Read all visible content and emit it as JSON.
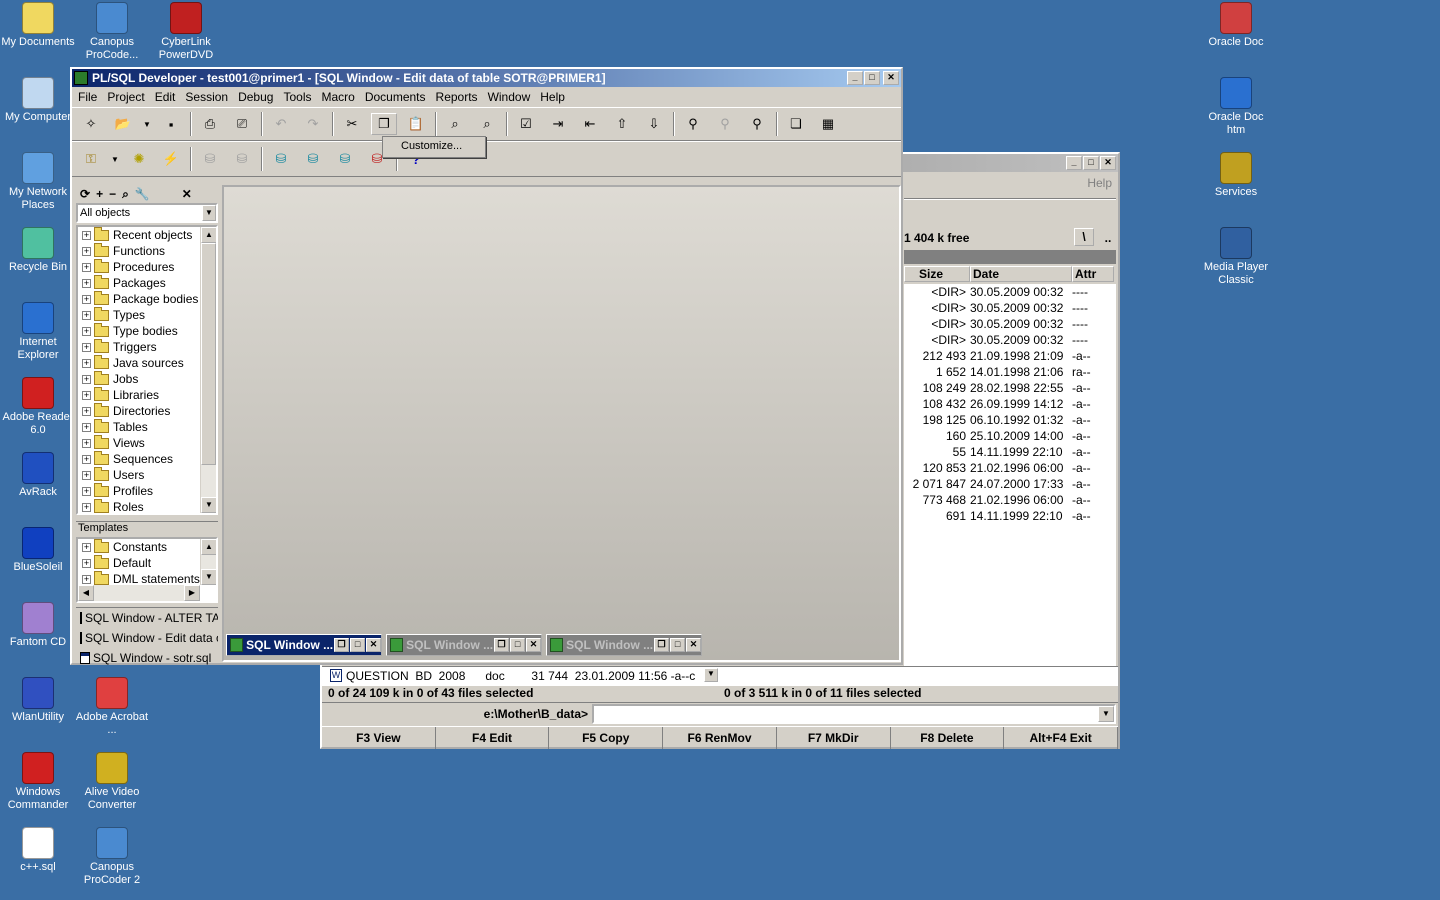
{
  "desktop": {
    "icons_left": [
      {
        "label": "My Documents",
        "icon": "folder-documents-icon"
      },
      {
        "label": "Canopus ProCode...",
        "icon": "canopus-icon"
      },
      {
        "label": "CyberLink PowerDVD",
        "icon": "dvd-icon"
      },
      {
        "label": "My Computer",
        "icon": "computer-icon"
      },
      {
        "label": "My Network Places",
        "icon": "network-icon"
      },
      {
        "label": "Recycle Bin",
        "icon": "recycle-bin-icon"
      },
      {
        "label": "Internet Explorer",
        "icon": "ie-icon"
      },
      {
        "label": "Adobe Reader 6.0",
        "icon": "adobe-reader-icon"
      },
      {
        "label": "AvRack",
        "icon": "avrack-icon"
      },
      {
        "label": "BlueSoleil",
        "icon": "bluetooth-icon"
      },
      {
        "label": "Fantom CD",
        "icon": "fantom-cd-icon"
      },
      {
        "label": "WlanUtility",
        "icon": "wlan-icon"
      },
      {
        "label": "Adobe Acrobat ...",
        "icon": "acrobat-icon"
      },
      {
        "label": "Windows Commander",
        "icon": "floppy-icon"
      },
      {
        "label": "Alive Video Converter",
        "icon": "video-converter-icon"
      },
      {
        "label": "c++.sql",
        "icon": "sql-file-icon"
      },
      {
        "label": "Canopus ProCoder 2",
        "icon": "canopus-icon"
      }
    ],
    "icons_right": [
      {
        "label": "Oracle Doc",
        "icon": "oracle-doc-icon"
      },
      {
        "label": "Oracle Doc htm",
        "icon": "ie-icon"
      },
      {
        "label": "Services",
        "icon": "gears-icon"
      },
      {
        "label": "Media Player Classic",
        "icon": "media-player-icon"
      }
    ]
  },
  "commander": {
    "help": "Help",
    "free": "1 404 k free",
    "root_btn": "\\",
    "up_btn": "..",
    "columns": [
      "Size",
      "Date",
      "Attr"
    ],
    "rows": [
      {
        "size": "<DIR>",
        "date": "30.05.2009 00:32",
        "attr": "----"
      },
      {
        "size": "<DIR>",
        "date": "30.05.2009 00:32",
        "attr": "----"
      },
      {
        "size": "<DIR>",
        "date": "30.05.2009 00:32",
        "attr": "----"
      },
      {
        "size": "<DIR>",
        "date": "30.05.2009 00:32",
        "attr": "----"
      },
      {
        "size": "212 493",
        "date": "21.09.1998 21:09",
        "attr": "-a--"
      },
      {
        "size": "1 652",
        "date": "14.01.1998 21:06",
        "attr": "ra--"
      },
      {
        "size": "108 249",
        "date": "28.02.1998 22:55",
        "attr": "-a--"
      },
      {
        "size": "108 432",
        "date": "26.09.1999 14:12",
        "attr": "-a--"
      },
      {
        "size": "198 125",
        "date": "06.10.1992 01:32",
        "attr": "-a--"
      },
      {
        "size": "160",
        "date": "25.10.2009 14:00",
        "attr": "-a--"
      },
      {
        "size": "55",
        "date": "14.11.1999 22:10",
        "attr": "-a--"
      },
      {
        "size": "120 853",
        "date": "21.02.1996 06:00",
        "attr": "-a--"
      },
      {
        "size": "2 071 847",
        "date": "24.07.2000 17:33",
        "attr": "-a--"
      },
      {
        "size": "773 468",
        "date": "21.02.1996 06:00",
        "attr": "-a--"
      },
      {
        "size": "691",
        "date": "14.11.1999 22:10",
        "attr": "-a--"
      }
    ],
    "current_file": "QUESTION  BD  2008      doc        31 744  23.01.2009 11:56 -a--c",
    "status_left": "0 of 24 109 k in 0 of 43 files selected",
    "status_right": "0 of 3 511 k in 0 of 11 files selected",
    "path": "e:\\Mother\\B_data>",
    "fkeys": [
      "F3 View",
      "F4 Edit",
      "F5 Copy",
      "F6 RenMov",
      "F7 MkDir",
      "F8 Delete",
      "Alt+F4 Exit"
    ]
  },
  "plsql": {
    "title": "PL/SQL Developer - test001@primer1 - [SQL Window - Edit data of table SOTR@PRIMER1]",
    "menu": [
      "File",
      "Project",
      "Edit",
      "Session",
      "Debug",
      "Tools",
      "Macro",
      "Documents",
      "Reports",
      "Window",
      "Help"
    ],
    "popup": "Customize...",
    "object_filter": "All objects",
    "objects": [
      "Recent objects",
      "Functions",
      "Procedures",
      "Packages",
      "Package bodies",
      "Types",
      "Type bodies",
      "Triggers",
      "Java sources",
      "Jobs",
      "Libraries",
      "Directories",
      "Tables",
      "Views",
      "Sequences",
      "Users",
      "Profiles",
      "Roles"
    ],
    "templates_label": "Templates",
    "templates": [
      "Constants",
      "Default",
      "DML statements"
    ],
    "window_list": [
      "SQL Window - ALTER TA",
      "SQL Window - Edit data of",
      "SQL Window - sotr.sql"
    ],
    "tabs": [
      "SQL Window ...",
      "SQL Window ...",
      "SQL Window ..."
    ]
  }
}
